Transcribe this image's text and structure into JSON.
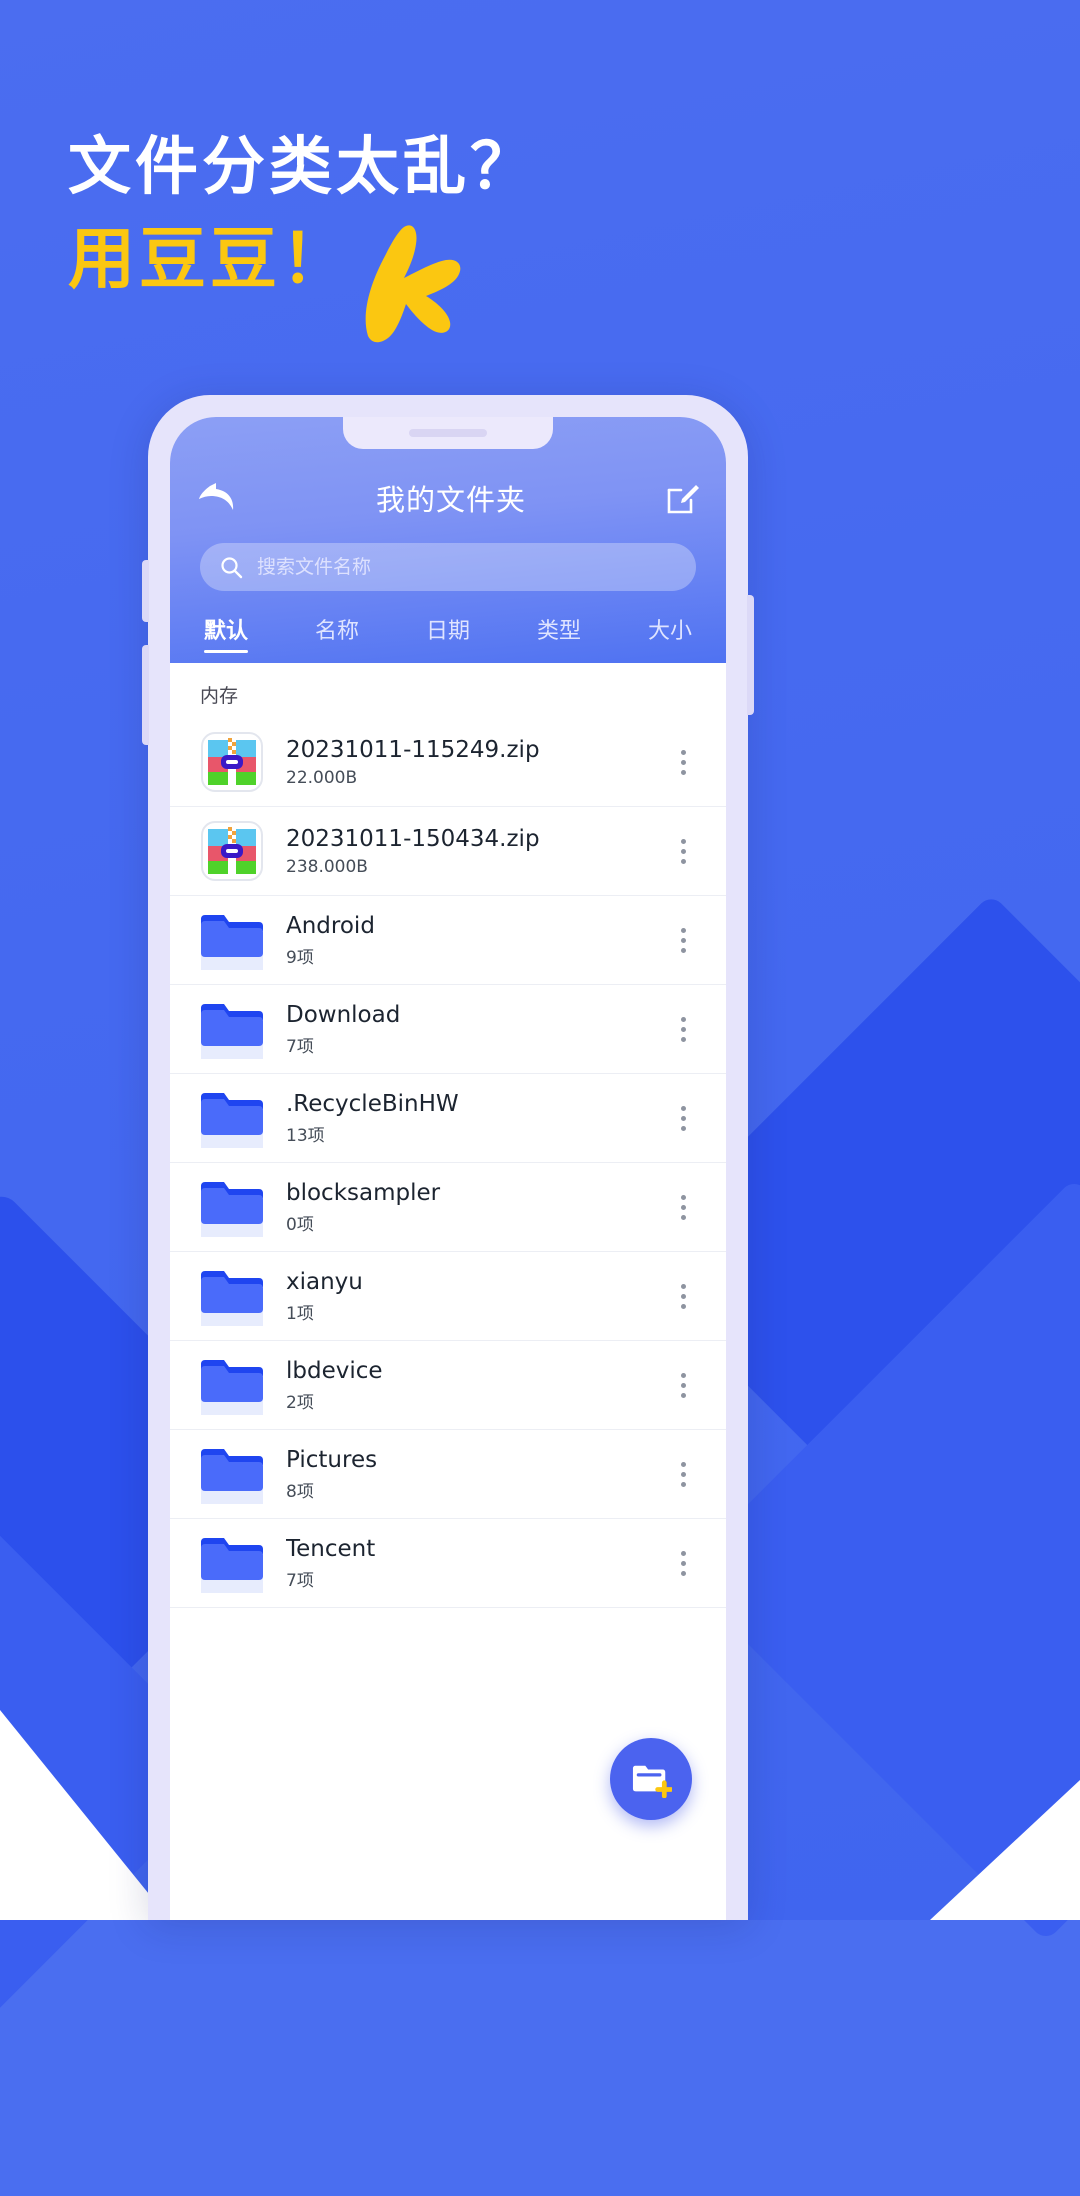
{
  "promo": {
    "headline_line1": "文件分类太乱？",
    "headline_line2": "用豆豆！",
    "colors": {
      "background": "#4a6ef0",
      "headline_white": "#ffffff",
      "headline_yellow": "#fbc711"
    }
  },
  "app": {
    "header": {
      "back_icon": "back-arrow-icon",
      "title": "我的文件夹",
      "edit_icon": "edit-pencil-icon"
    },
    "search": {
      "icon": "search-icon",
      "placeholder": "搜索文件名称",
      "value": ""
    },
    "tabs": [
      {
        "label": "默认",
        "active": true
      },
      {
        "label": "名称",
        "active": false
      },
      {
        "label": "日期",
        "active": false
      },
      {
        "label": "类型",
        "active": false
      },
      {
        "label": "大小",
        "active": false
      }
    ],
    "section_label": "内存",
    "rows": [
      {
        "icon": "zip-file-icon",
        "name": "20231011-115249.zip",
        "sub": "22.000B"
      },
      {
        "icon": "zip-file-icon",
        "name": "20231011-150434.zip",
        "sub": "238.000B"
      },
      {
        "icon": "folder-icon",
        "name": "Android",
        "sub": "9项"
      },
      {
        "icon": "folder-icon",
        "name": "Download",
        "sub": "7项"
      },
      {
        "icon": "folder-icon",
        "name": ".RecycleBinHW",
        "sub": "13项"
      },
      {
        "icon": "folder-icon",
        "name": "blocksampler",
        "sub": "0项"
      },
      {
        "icon": "folder-icon",
        "name": "xianyu",
        "sub": "1项"
      },
      {
        "icon": "folder-icon",
        "name": "lbdevice",
        "sub": "2项"
      },
      {
        "icon": "folder-icon",
        "name": "Pictures",
        "sub": "8项"
      },
      {
        "icon": "folder-icon",
        "name": "Tencent",
        "sub": "7项"
      }
    ],
    "fab": {
      "icon": "new-folder-icon",
      "color": "#4b63ef"
    },
    "more_icon": "more-vertical-icon"
  }
}
